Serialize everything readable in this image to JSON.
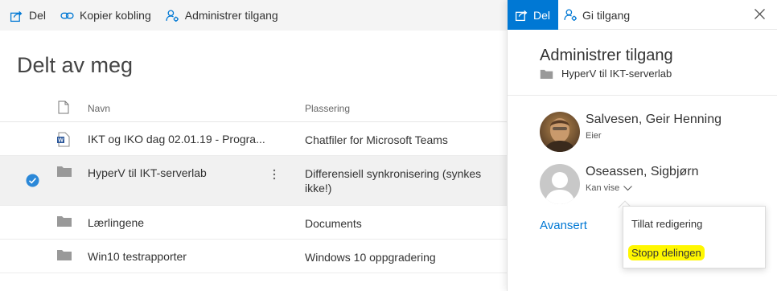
{
  "toolbar": {
    "share_label": "Del",
    "copy_link_label": "Kopier kobling",
    "manage_access_label": "Administrer tilgang"
  },
  "page": {
    "title": "Delt av meg"
  },
  "list": {
    "columns": {
      "name": "Navn",
      "location": "Plassering"
    },
    "rows": [
      {
        "name": "IKT og IKO dag 02.01.19 - Progra...",
        "location": "Chatfiler for Microsoft Teams",
        "icon": "word-doc-icon",
        "selected": false
      },
      {
        "name": "HyperV til IKT-serverlab",
        "location": "Differensiell synkronisering (synkes ikke!)",
        "icon": "folder-icon",
        "selected": true
      },
      {
        "name": "Lærlingene",
        "location": "Documents",
        "icon": "folder-icon",
        "selected": false
      },
      {
        "name": "Win10 testrapporter",
        "location": "Windows 10 oppgradering",
        "icon": "folder-icon",
        "selected": false
      }
    ]
  },
  "panel": {
    "tab_share": "Del",
    "tab_grant": "Gi tilgang",
    "title": "Administrer tilgang",
    "item_name": "HyperV til IKT-serverlab",
    "people": [
      {
        "name": "Salvesen, Geir Henning",
        "role": "Eier"
      },
      {
        "name": "Oseassen, Sigbjørn",
        "role": "Kan vise"
      }
    ],
    "advanced_label": "Avansert"
  },
  "menu": {
    "allow_edit": "Tillat redigering",
    "stop_sharing": "Stopp delingen"
  },
  "colors": {
    "accent": "#0078d4",
    "highlight": "#fff700"
  }
}
